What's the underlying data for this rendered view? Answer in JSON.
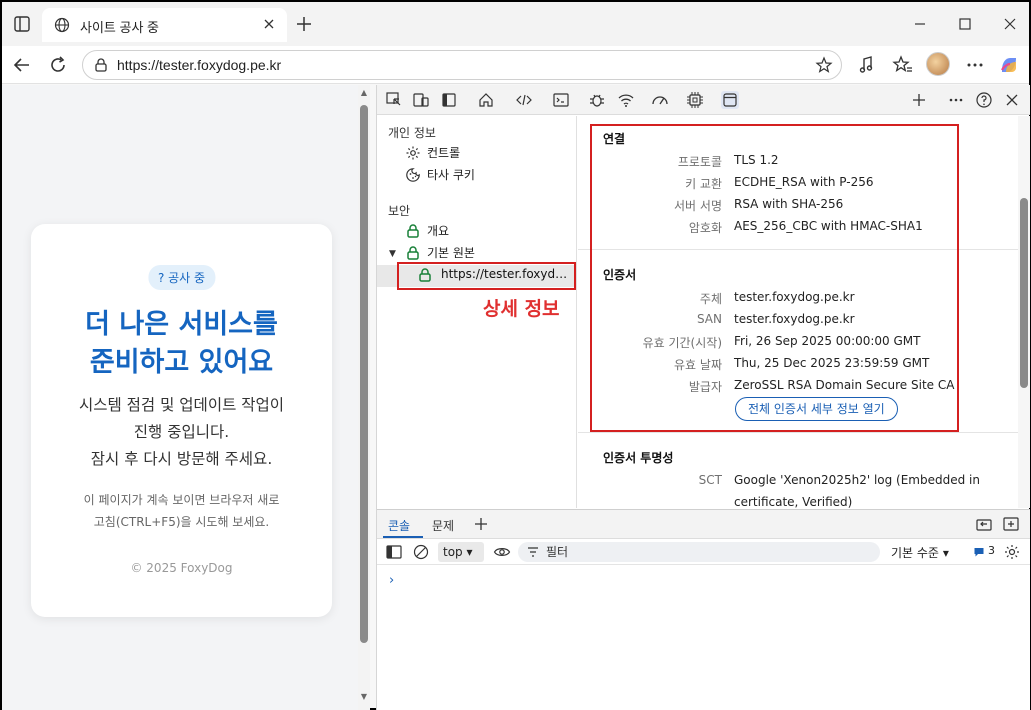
{
  "browser": {
    "tab_title": "사이트 공사 중",
    "url": "https://tester.foxydog.pe.kr"
  },
  "page": {
    "badge": "? 공사 중",
    "headline_line1": "더 나은 서비스를",
    "headline_line2": "준비하고 있어요",
    "desc_line1": "시스템 점검 및 업데이트 작업이",
    "desc_line2": "진행 중입니다.",
    "desc_line3": "잠시 후 다시 방문해 주세요.",
    "hint_line1": "이 페이지가 계속 보이면 브라우저 새로",
    "hint_line2": "고침(CTRL+F5)을 시도해 보세요.",
    "copyright": "© 2025 FoxyDog"
  },
  "devtools": {
    "tree": {
      "privacy_header": "개인 정보",
      "controls": "컨트롤",
      "third_party_cookies": "타사 쿠키",
      "security_header": "보안",
      "overview": "개요",
      "main_origin": "기본 원본",
      "origin_url": "https://tester.foxydog.pe.kr"
    },
    "annotation": "상세 정보",
    "connection": {
      "title": "연결",
      "rows": [
        {
          "key": "프로토콜",
          "value": "TLS 1.2"
        },
        {
          "key": "키 교환",
          "value": "ECDHE_RSA with P-256"
        },
        {
          "key": "서버 서명",
          "value": "RSA with SHA-256"
        },
        {
          "key": "암호화",
          "value": "AES_256_CBC with HMAC-SHA1"
        }
      ]
    },
    "certificate": {
      "title": "인증서",
      "rows": [
        {
          "key": "주체",
          "value": "tester.foxydog.pe.kr"
        },
        {
          "key": "SAN",
          "value": "tester.foxydog.pe.kr"
        },
        {
          "key": "유효 기간(시작)",
          "value": "Fri, 26 Sep 2025 00:00:00 GMT"
        },
        {
          "key": "유효 날짜",
          "value": "Thu, 25 Dec 2025 23:59:59 GMT"
        },
        {
          "key": "발급자",
          "value": "ZeroSSL RSA Domain Secure Site CA"
        }
      ],
      "open_button": "전체 인증서 세부 정보 열기"
    },
    "transparency": {
      "title": "인증서 투명성",
      "key": "SCT",
      "value_line1": "Google 'Xenon2025h2' log (Embedded in",
      "value_line2": "certificate, Verified)"
    },
    "drawer": {
      "tab_console": "콘솔",
      "tab_issues": "문제",
      "context": "top",
      "filter_placeholder": "필터",
      "levels": "기본 수준",
      "issues_count": "3"
    }
  },
  "colors": {
    "accent_blue": "#1565c0",
    "annotation_red": "#d42020",
    "lock_green": "#188038"
  }
}
